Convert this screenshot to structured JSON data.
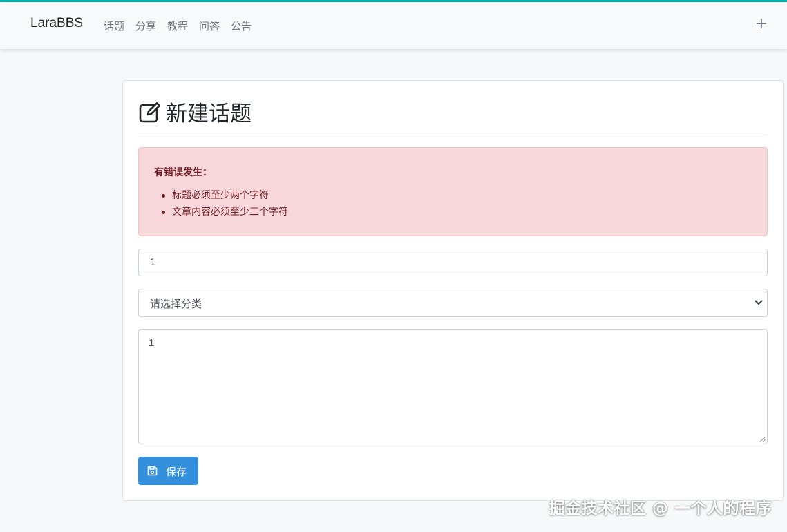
{
  "navbar": {
    "brand": "LaraBBS",
    "items": [
      "话题",
      "分享",
      "教程",
      "问答",
      "公告"
    ],
    "plus": "+"
  },
  "page": {
    "title": "新建话题",
    "title_icon": "edit-icon"
  },
  "alert": {
    "heading": "有错误发生：",
    "errors": [
      "标题必须至少两个字符",
      "文章内容必须至少三个字符"
    ]
  },
  "form": {
    "title_value": "1",
    "category_selected": "请选择分类",
    "body_value": "1",
    "save_label": "保存",
    "save_icon": "save-icon"
  },
  "watermark": "掘金技术社区 @ 一个人的程序",
  "colors": {
    "accent_top": "#00b5ad",
    "primary": "#3490dc",
    "alert_bg": "#f8d7da",
    "alert_text": "#721c24"
  }
}
